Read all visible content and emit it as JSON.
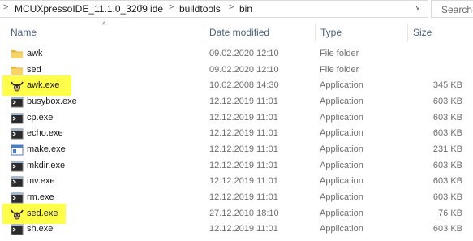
{
  "address": {
    "crumbs": [
      "MCUXpressoIDE_11.1.0_3209",
      "ide",
      "buildtools",
      "bin"
    ],
    "separator": ">",
    "dropdown": "˅",
    "refresh": "↻"
  },
  "search": {
    "placeholder": "Search"
  },
  "columns": {
    "name": "Name",
    "date": "Date modified",
    "type": "Type",
    "size": "Size",
    "sort_arrow": "^"
  },
  "rows": [
    {
      "name": "awk",
      "date": "09.02.2020 12:10",
      "type": "File folder",
      "size": "",
      "icon": "folder-icon"
    },
    {
      "name": "sed",
      "date": "09.02.2020 12:10",
      "type": "File folder",
      "size": "",
      "icon": "folder-icon"
    },
    {
      "name": "awk.exe",
      "date": "10.02.2008 14:30",
      "type": "Application",
      "size": "345 KB",
      "icon": "gnu-app-icon",
      "highlight": true
    },
    {
      "name": "busybox.exe",
      "date": "12.12.2019 11:01",
      "type": "Application",
      "size": "603 KB",
      "icon": "console-app-icon"
    },
    {
      "name": "cp.exe",
      "date": "12.12.2019 11:01",
      "type": "Application",
      "size": "603 KB",
      "icon": "console-app-icon"
    },
    {
      "name": "echo.exe",
      "date": "12.12.2019 11:01",
      "type": "Application",
      "size": "603 KB",
      "icon": "console-app-icon"
    },
    {
      "name": "make.exe",
      "date": "12.12.2019 11:01",
      "type": "Application",
      "size": "231 KB",
      "icon": "window-app-icon"
    },
    {
      "name": "mkdir.exe",
      "date": "12.12.2019 11:01",
      "type": "Application",
      "size": "603 KB",
      "icon": "console-app-icon"
    },
    {
      "name": "mv.exe",
      "date": "12.12.2019 11:01",
      "type": "Application",
      "size": "603 KB",
      "icon": "console-app-icon"
    },
    {
      "name": "rm.exe",
      "date": "12.12.2019 11:01",
      "type": "Application",
      "size": "603 KB",
      "icon": "console-app-icon"
    },
    {
      "name": "sed.exe",
      "date": "27.12.2010 18:10",
      "type": "Application",
      "size": "76 KB",
      "icon": "gnu-app-icon",
      "highlight": true
    },
    {
      "name": "sh.exe",
      "date": "12.12.2019 11:01",
      "type": "Application",
      "size": "603 KB",
      "icon": "console-app-icon"
    }
  ],
  "colors": {
    "highlight": "#ffff4a",
    "header_text": "#4c607a",
    "folder": "#f7c948"
  }
}
